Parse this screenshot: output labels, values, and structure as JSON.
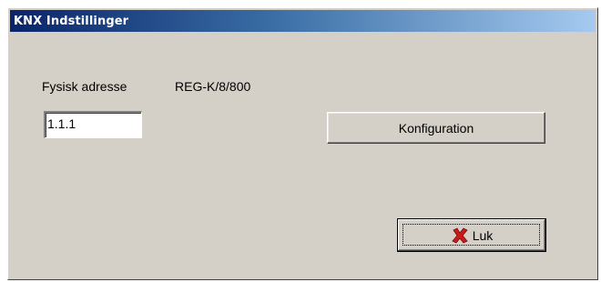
{
  "window": {
    "title": "KNX Indstillinger"
  },
  "address": {
    "label": "Fysisk adresse",
    "device_model": "REG-K/8/800",
    "value": "1.1.1"
  },
  "buttons": {
    "configure_label": "Konfiguration",
    "close_label": "Luk",
    "close_icon": "red-x-icon"
  },
  "colors": {
    "title_bar_start": "#0a246a",
    "title_bar_end": "#a6caf0",
    "dialog_background": "#d4d0c8",
    "close_icon": "#cc1a1a"
  }
}
